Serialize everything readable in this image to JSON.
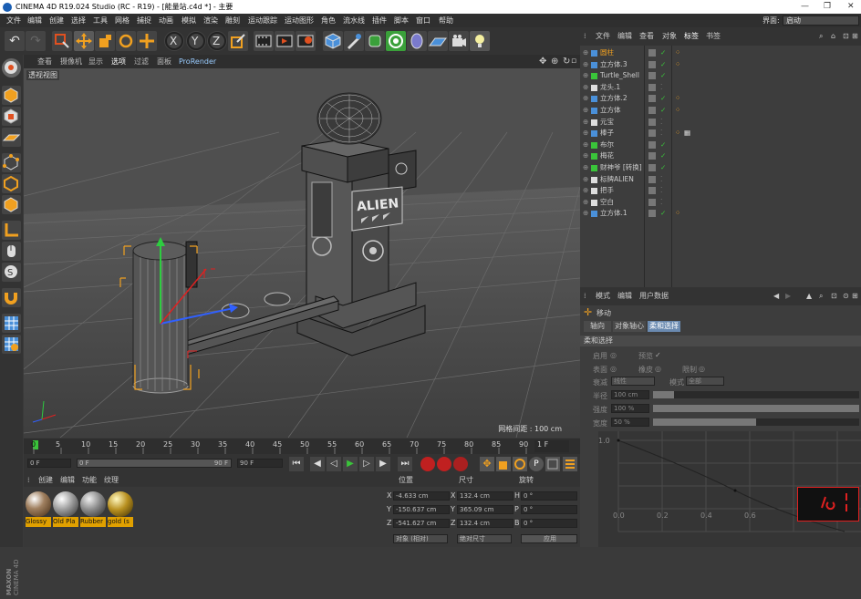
{
  "titlebar": {
    "title": "CINEMA 4D R19.024 Studio (RC - R19) - [能量站.c4d *] - 主要"
  },
  "menu": [
    "文件",
    "编辑",
    "创建",
    "选择",
    "工具",
    "网格",
    "捕捉",
    "动画",
    "模拟",
    "渲染",
    "雕刻",
    "运动跟踪",
    "运动图形",
    "角色",
    "流水线",
    "插件",
    "脚本",
    "窗口",
    "帮助"
  ],
  "layout": {
    "label": "界面:",
    "value": "启动"
  },
  "viewport": {
    "menu": [
      "查看",
      "摄像机",
      "显示",
      "选项",
      "过滤",
      "面板",
      "ProRender"
    ],
    "label": "透视视图",
    "grid_info": "网格间距 : 100 cm",
    "sign_text": "ALIEN"
  },
  "timeline": {
    "ticks": [
      "0",
      "5",
      "10",
      "15",
      "20",
      "25",
      "30",
      "35",
      "40",
      "45",
      "50",
      "55",
      "60",
      "65",
      "70",
      "75",
      "80",
      "85",
      "90"
    ],
    "end_frame": "1 F"
  },
  "playbar": {
    "current": "0 F",
    "min": "0 F",
    "max": "90 F",
    "end": "90 F"
  },
  "materials": {
    "menu": [
      "创建",
      "编辑",
      "功能",
      "纹理"
    ],
    "items": [
      "Glossy",
      "Old Pla",
      "Rubber",
      "gold (s"
    ]
  },
  "coords": {
    "headers": [
      "位置",
      "尺寸",
      "旋转"
    ],
    "rows": [
      {
        "axis": "X",
        "pos": "-4.633 cm",
        "size_axis": "X",
        "size": "132.4 cm",
        "rot_axis": "H",
        "rot": "0 °"
      },
      {
        "axis": "Y",
        "pos": "-150.637 cm",
        "size_axis": "Y",
        "size": "365.09 cm",
        "rot_axis": "P",
        "rot": "0 °"
      },
      {
        "axis": "Z",
        "pos": "-541.627 cm",
        "size_axis": "Z",
        "size": "132.4 cm",
        "rot_axis": "B",
        "rot": "0 °"
      }
    ],
    "mode": "对象 (相对)",
    "size_mode": "绝对尺寸",
    "apply": "应用"
  },
  "objmgr": {
    "menu": [
      "文件",
      "编辑",
      "查看",
      "对象",
      "标签",
      "书签"
    ],
    "objects": [
      {
        "name": "圆柱",
        "highlight": true
      },
      {
        "name": "立方体.3"
      },
      {
        "name": "Turtle_Shell"
      },
      {
        "name": "龙头.1"
      },
      {
        "name": "立方体.2"
      },
      {
        "name": "立方体"
      },
      {
        "name": "元宝"
      },
      {
        "name": "棒子"
      },
      {
        "name": "布尔"
      },
      {
        "name": "梅花"
      },
      {
        "name": "财神爷 [转换]"
      },
      {
        "name": "标牌ALIEN"
      },
      {
        "name": "把手"
      },
      {
        "name": "空白"
      },
      {
        "name": "立方体.1"
      }
    ]
  },
  "attrmgr": {
    "menu": [
      "模式",
      "编辑",
      "用户数据"
    ],
    "tool": "移动",
    "tabs": [
      "轴向",
      "对象轴心",
      "柔和选择"
    ],
    "section": "柔和选择",
    "fields": {
      "enable": "启用",
      "preview": "预览",
      "surface": "表面",
      "rubber": "橡皮",
      "restrict": "限制",
      "falloff_label": "衰减",
      "falloff": "线性",
      "mode_label": "模式",
      "mode": "全部",
      "radius_label": "半径",
      "radius": "100 cm",
      "strength_label": "强度",
      "strength": "100 %",
      "width_label": "宽度",
      "width": "50 %"
    },
    "graph_x": [
      "0.0",
      "0.2",
      "0.4",
      "0.6"
    ],
    "graph_y": "1.0"
  },
  "brand": {
    "line1": "MAXON",
    "line2": "CINEMA 4D"
  }
}
